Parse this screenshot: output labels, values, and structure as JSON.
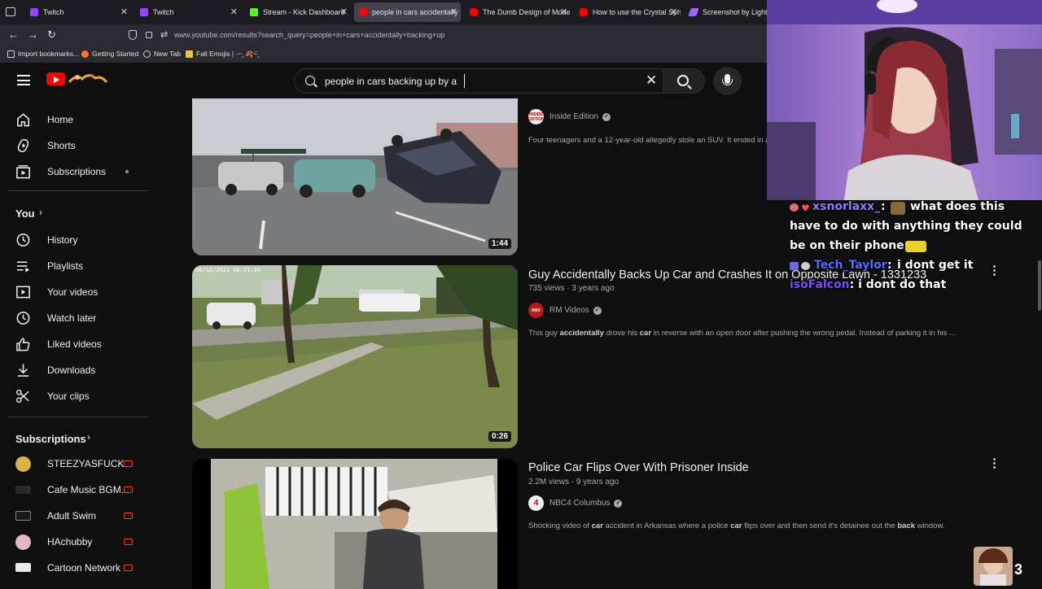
{
  "browser": {
    "tabs": [
      {
        "label": "Twitch",
        "color": "#9146ff",
        "active": false
      },
      {
        "label": "Twitch",
        "color": "#9146ff",
        "active": false
      },
      {
        "label": "Stream - Kick Dashboard",
        "color": "#53fc18",
        "active": false
      },
      {
        "label": "people in cars accidentally",
        "color": "#ff0000",
        "active": true
      },
      {
        "label": "The Dumb Design of Mode",
        "color": "#ff0000",
        "active": false
      },
      {
        "label": "How to use the Crystal Sph",
        "color": "#ff0000",
        "active": false
      },
      {
        "label": "Screenshot by Lightshot",
        "color": "#a064ff",
        "active": false
      }
    ],
    "url": "www.youtube.com/results?search_query=people+in+cars+accidentally+backing+up",
    "bookmarks": [
      "Import bookmarks...",
      "Getting Started",
      "New Tab",
      "Fall Emojis | ·ᵕ·̫ 🍂ᵕ̈·̫"
    ]
  },
  "youtube": {
    "search_value": "people in cars backing up by a",
    "sidebar": {
      "main": [
        "Home",
        "Shorts",
        "Subscriptions"
      ],
      "you_heading": "You",
      "you_items": [
        "History",
        "Playlists",
        "Your videos",
        "Watch later",
        "Liked videos",
        "Downloads",
        "Your clips"
      ],
      "subs_heading": "Subscriptions",
      "subs": [
        "STEEZYASFUCK",
        "Cafe Music BGM...",
        "Adult Swim",
        "HAchubby",
        "Cartoon Network"
      ]
    },
    "results": [
      {
        "channel": "Inside Edition",
        "channel_badge": "INSIDE EDITION",
        "desc": "Four teenagers and a 12-year-old allegedly stole an SUV. It ended in a",
        "duration": "1:44"
      },
      {
        "title": "Guy Accidentally Backs Up Car and Crashes It on Opposite Lawn - 1331233",
        "meta": "735 views · 3 years ago",
        "channel": "RM Videos",
        "channel_badge": "RMV",
        "desc_parts": [
          "This guy ",
          "accidentally",
          " drove his ",
          "car",
          " in reverse with an open door after pushing the wrong pedal. Instead of parking it in his ..."
        ],
        "duration": "0:26",
        "cam_stamp": "06/12/2022 06:51:34"
      },
      {
        "title": "Police Car Flips Over With Prisoner Inside",
        "meta": "2.2M views · 9 years ago",
        "channel": "NBC4 Columbus",
        "channel_badge": "4",
        "desc_parts": [
          "Shocking video of ",
          "car",
          " accident in Arkansas where a police ",
          "car",
          " flips over and then send it's detainee out the ",
          "back",
          " window."
        ]
      }
    ]
  },
  "stream": {
    "chat": [
      {
        "user": "xsnorlaxx_",
        "msg_lines": [
          "what does this",
          "have to do with anything they could",
          "be on their phone"
        ]
      },
      {
        "user": "Tech_Taylor",
        "msg_lines": [
          "i dont get it"
        ]
      },
      {
        "user": "isoFalcon",
        "msg_lines": [
          "i dont do that"
        ]
      }
    ],
    "viewer_count": "3"
  }
}
